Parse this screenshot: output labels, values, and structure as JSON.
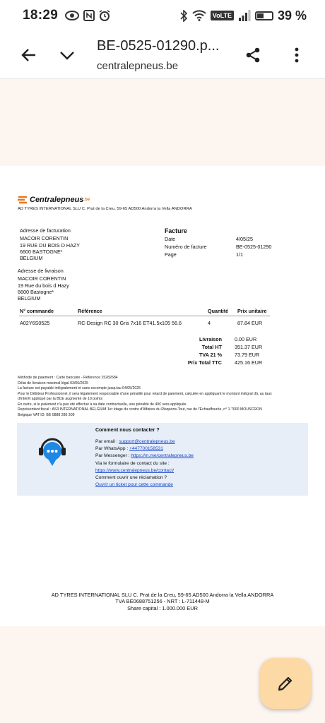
{
  "status": {
    "time": "18:29",
    "volte": "VoLTE",
    "battery": "39 %"
  },
  "topbar": {
    "title": "BE-0525-01290.p...",
    "domain": "centralepneus.be"
  },
  "invoice": {
    "logo": "Centralepneus",
    "logo_suffix": ".be",
    "company_line": "AD TYRES INTERNATIONAL SLU C. Prat de la Creu, 59-65 AD500 Andorra la Vella ANDORRA",
    "billing": {
      "heading": "Adresse de facturation",
      "lines": [
        "MACOIR CORENTIN",
        "19 RUE DU BOIS D HAZY",
        "6600 BASTOGNE*",
        "BELGIUM"
      ]
    },
    "delivery": {
      "heading": "Adresse de livraison",
      "lines": [
        "MACOIR CORENTIN",
        "19 Rue du bois d Hazy",
        "6600 Bastogne*",
        "BELGIUM"
      ]
    },
    "facture": {
      "heading": "Facture",
      "labels": [
        "Date",
        "Numéro de facture",
        "Page"
      ],
      "values": [
        "4/05/25",
        "BE-0525-01290",
        "1/1"
      ]
    },
    "table": {
      "headers": [
        "N° commande",
        "Référence",
        "Quantité",
        "Prix unitaire"
      ],
      "row": [
        "A02Y6S0525",
        "RC-Design RC 30 Gris 7x16 ET41.5x105 56.6",
        "4",
        "87.84 EUR"
      ]
    },
    "totals": {
      "labels": [
        "Livraison",
        "Total HT",
        "TVA 21 %",
        "Prix Total TTC"
      ],
      "values": [
        "0.00 EUR",
        "351.37 EUR",
        "73.79 EUR",
        "425.16 EUR"
      ]
    },
    "notes": [
      "Methode de paiement : Carte bancaire - Référence 25282684",
      "Délai de livraison maximal légal 03/06/2025",
      "La facture est payable intégralement et sans escompte jusqu'au 04/05/2025",
      "Pour le Débiteur Professionnel, il sera légalement responsable d'une pénalité pour retard de paiement, calculée en appliquant le montant intégral dû, au taux",
      "d'intérêt appliqué par la BCE augmenté de 10 points",
      "En outre, si le paiement n'a pas été effectué à sa date contractuelle, une pénalité de 40€ sera appliquée.",
      "Représentant fiscal : AS3 INTERNATIONAL BELGIUM 1er étage du centre d'Affaires du Risquons-Tout, rue de l'Echauffourée, n° 1 7000 MOUSCRON",
      "Belgique VAT ID: BE 0888 286 309"
    ],
    "contact": {
      "heading": "Comment nous contacter ?",
      "email_label": "Par email : ",
      "email": "support@centralepneus.be",
      "whatsapp_label": "Par WhatsApp : ",
      "whatsapp": "+447700158531",
      "messenger_label": "Par Messenger : ",
      "messenger": "https://m.me/centralepneus.be",
      "form_label": "Via le formulaire de contact du site :",
      "form_link": "https://www.centralepneus.be/contact/",
      "claim_label": "Comment ouvrir une réclamation ?",
      "claim_link": "Ouvrir un ticket pour cette commande"
    },
    "footer": [
      "AD TYRES INTERNATIONAL SLU C. Prat de la Creu, 59-65 AD500 Andorra la Vella ANDORRA",
      "TVA BE0688751256 - NRT : L-711448-M",
      "Share capital : 1.000.000 EUR"
    ]
  }
}
